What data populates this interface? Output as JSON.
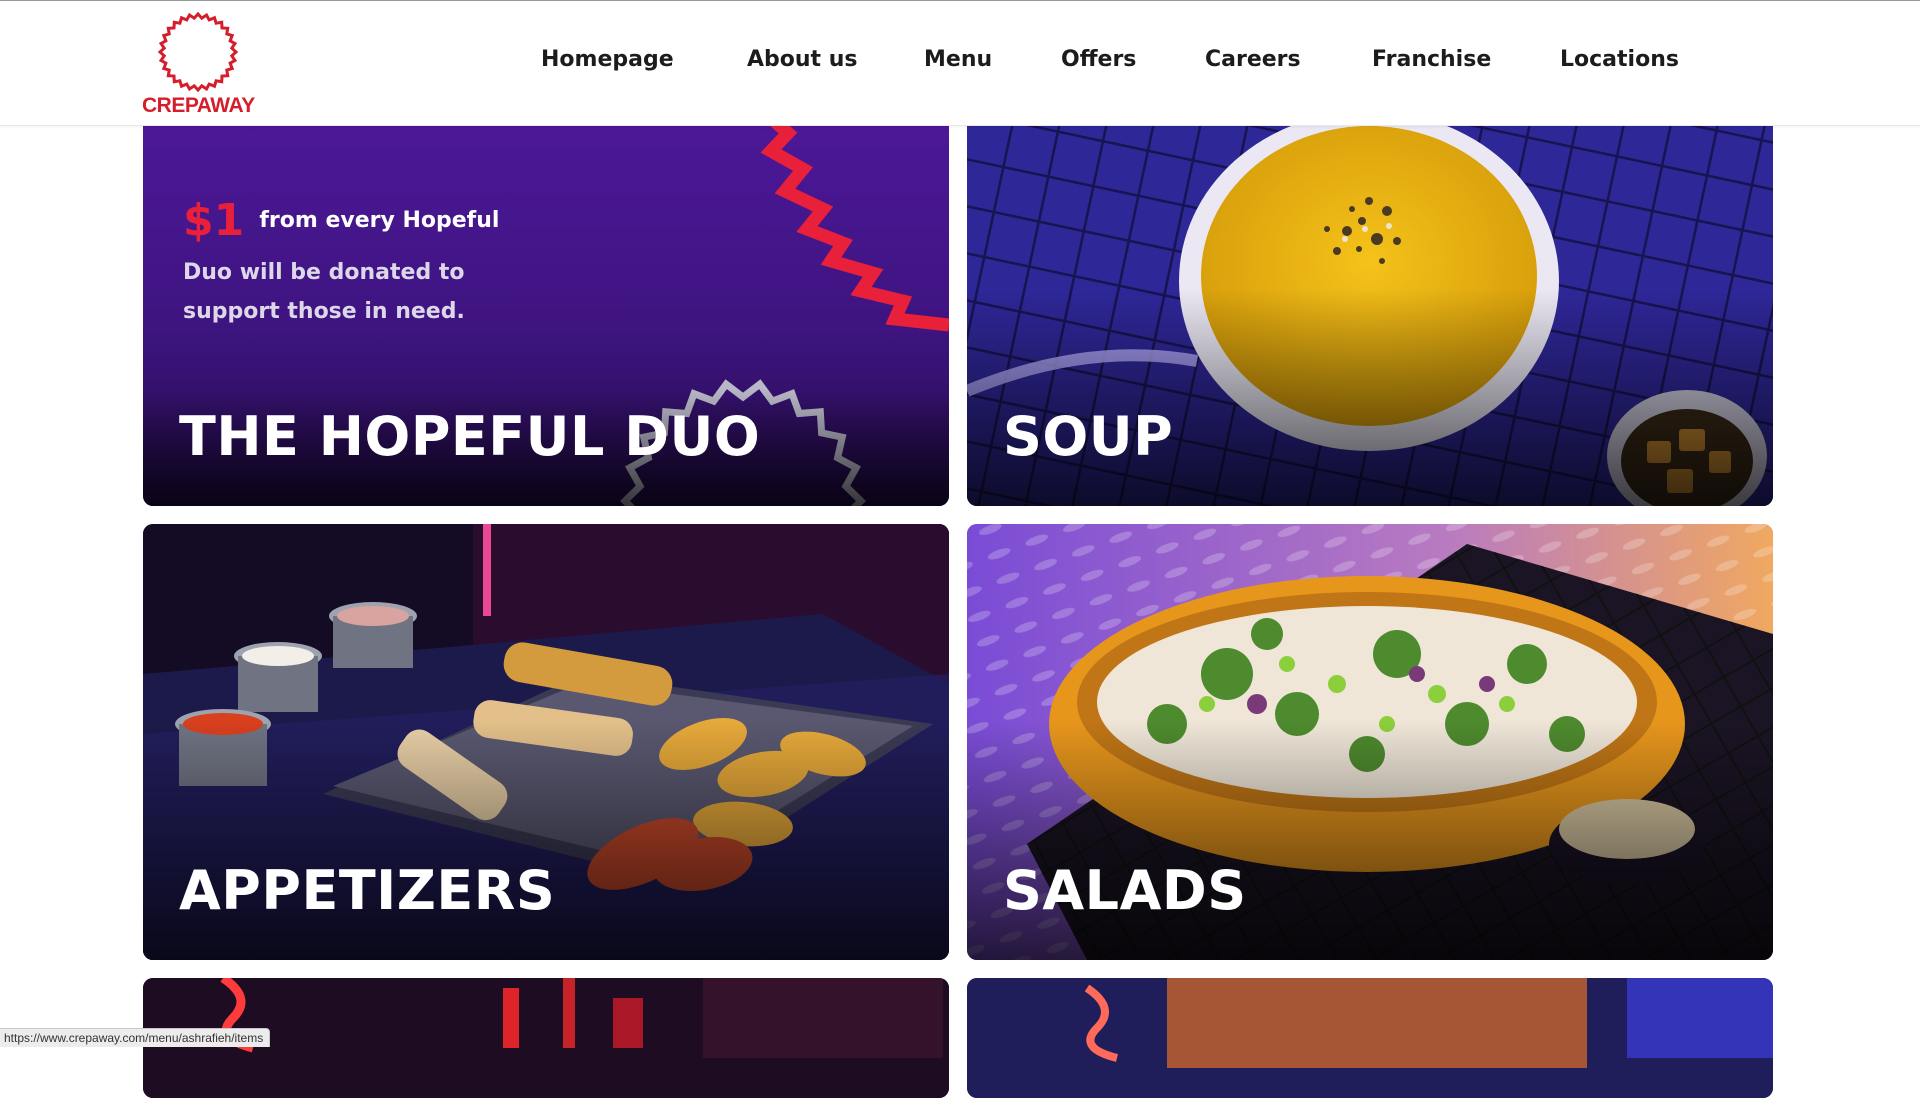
{
  "brand": {
    "name": "CREPAWAY",
    "color": "#d41e2c"
  },
  "nav": [
    {
      "label": "Homepage"
    },
    {
      "label": "About us"
    },
    {
      "label": "Menu"
    },
    {
      "label": "Offers"
    },
    {
      "label": "Careers"
    },
    {
      "label": "Franchise"
    },
    {
      "label": "Locations"
    }
  ],
  "categories": [
    {
      "title": "THE HOPEFUL DUO",
      "promo": {
        "amount": "$1",
        "line1": "from every Hopeful",
        "line2": "Duo will be donated to",
        "line3": "support those in need."
      }
    },
    {
      "title": "SOUP"
    },
    {
      "title": "APPETIZERS"
    },
    {
      "title": "SALADS"
    }
  ],
  "status_bar": {
    "url": "https://www.crepaway.com/menu/ashrafieh/items"
  },
  "colors": {
    "accent": "#d41e2c",
    "promo_purple": "#4a1896",
    "promo_red": "#e8203a"
  }
}
